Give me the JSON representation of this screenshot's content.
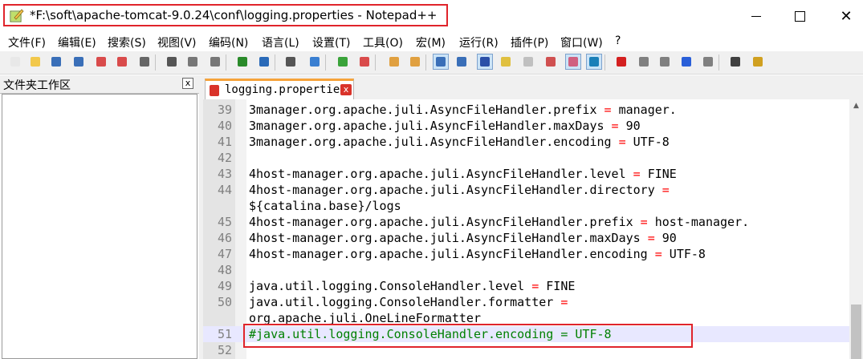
{
  "window": {
    "title": "*F:\\soft\\apache-tomcat-9.0.24\\conf\\logging.properties - Notepad++",
    "minimize_label": "—",
    "close_label": "✕"
  },
  "menu": [
    {
      "label": "文件(F)",
      "name": "file"
    },
    {
      "label": "编辑(E)",
      "name": "edit"
    },
    {
      "label": "搜索(S)",
      "name": "search"
    },
    {
      "label": "视图(V)",
      "name": "view"
    },
    {
      "label": "编码(N)",
      "name": "encoding"
    },
    {
      "label": "语言(L)",
      "name": "language"
    },
    {
      "label": "设置(T)",
      "name": "settings"
    },
    {
      "label": "工具(O)",
      "name": "tools"
    },
    {
      "label": "宏(M)",
      "name": "macro"
    },
    {
      "label": "运行(R)",
      "name": "run"
    },
    {
      "label": "插件(P)",
      "name": "plugins"
    },
    {
      "label": "窗口(W)",
      "name": "window"
    },
    {
      "label": "?",
      "name": "help"
    }
  ],
  "toolbar": {
    "icons": [
      "new-file-icon",
      "open-file-icon",
      "save-icon",
      "save-all-icon",
      "close-icon",
      "close-all-icon",
      "print-icon",
      "cut-icon",
      "copy-icon",
      "paste-icon",
      "undo-icon",
      "redo-icon",
      "find-icon",
      "replace-icon",
      "zoom-in-icon",
      "zoom-out-icon",
      "sync-vertical-icon",
      "sync-horizontal-icon",
      "word-wrap-icon",
      "show-all-chars-icon",
      "indent-guide-icon",
      "udl-icon",
      "doc-map-icon",
      "function-list-icon",
      "folder-workspace-icon",
      "monitoring-icon",
      "record-macro-icon",
      "stop-record-icon",
      "playback-macro-icon",
      "run-macro-multiple-icon",
      "save-macro-icon",
      "html-tag-icon",
      "spell-check-icon"
    ]
  },
  "workspace": {
    "title": "文件夹工作区",
    "close_label": "x"
  },
  "tab": {
    "label": "logging.properties",
    "close_label": "x"
  },
  "editor": {
    "lines": [
      {
        "n": "39",
        "key": "3manager.org.apache.juli.AsyncFileHandler.prefix",
        "op": "=",
        "val": "manager."
      },
      {
        "n": "40",
        "key": "3manager.org.apache.juli.AsyncFileHandler.maxDays",
        "op": "=",
        "val": "90"
      },
      {
        "n": "41",
        "key": "3manager.org.apache.juli.AsyncFileHandler.encoding",
        "op": "=",
        "val": "UTF-8"
      },
      {
        "n": "42",
        "key": "",
        "op": "",
        "val": ""
      },
      {
        "n": "43",
        "key": "4host-manager.org.apache.juli.AsyncFileHandler.level",
        "op": "=",
        "val": "FINE"
      },
      {
        "n": "44",
        "key": "4host-manager.org.apache.juli.AsyncFileHandler.directory",
        "op": "=",
        "val": ""
      },
      {
        "n": "",
        "key": "${catalina.base}/logs",
        "op": "",
        "val": ""
      },
      {
        "n": "45",
        "key": "4host-manager.org.apache.juli.AsyncFileHandler.prefix",
        "op": "=",
        "val": "host-manager."
      },
      {
        "n": "46",
        "key": "4host-manager.org.apache.juli.AsyncFileHandler.maxDays",
        "op": "=",
        "val": "90"
      },
      {
        "n": "47",
        "key": "4host-manager.org.apache.juli.AsyncFileHandler.encoding",
        "op": "=",
        "val": "UTF-8"
      },
      {
        "n": "48",
        "key": "",
        "op": "",
        "val": ""
      },
      {
        "n": "49",
        "key": "java.util.logging.ConsoleHandler.level",
        "op": "=",
        "val": "FINE"
      },
      {
        "n": "50",
        "key": "java.util.logging.ConsoleHandler.formatter",
        "op": "=",
        "val": ""
      },
      {
        "n": "",
        "key": "org.apache.juli.OneLineFormatter",
        "op": "",
        "val": ""
      },
      {
        "n": "51",
        "comment": "#java.util.logging.ConsoleHandler.encoding = UTF-8",
        "current": true
      },
      {
        "n": "52",
        "key": "",
        "op": "",
        "val": ""
      }
    ]
  },
  "scrollbar": {
    "up_arrow": "▲"
  },
  "colors": {
    "annotation_red": "#e0242b",
    "comment_green": "#008000",
    "operator_red": "#ff0000",
    "current_line": "#e8e8ff",
    "tab_accent": "#f6a33a"
  }
}
